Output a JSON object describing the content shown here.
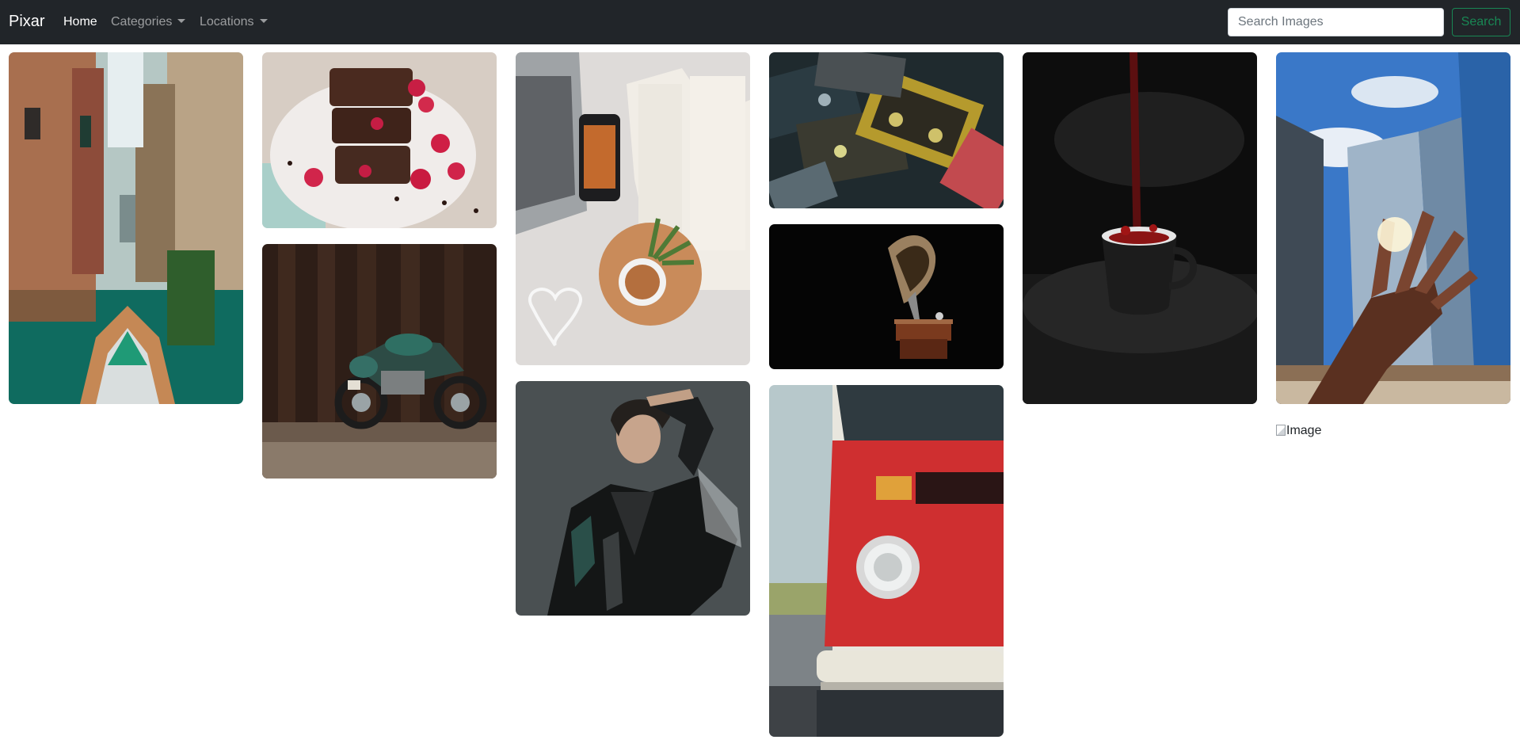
{
  "navbar": {
    "brand": "Pixar",
    "links": [
      {
        "label": "Home",
        "active": true
      },
      {
        "label": "Categories",
        "dropdown": true
      },
      {
        "label": "Locations",
        "dropdown": true
      }
    ],
    "search": {
      "placeholder": "Search Images",
      "value": "",
      "button_label": "Search"
    }
  },
  "gallery": {
    "images": [
      {
        "subject": "venice canal with boat"
      },
      {
        "subject": "chocolate brownies with raspberries"
      },
      {
        "subject": "motorcycle in forest"
      },
      {
        "subject": "laptop, phone, book and tea flat lay"
      },
      {
        "subject": "woman in shiny black jacket"
      },
      {
        "subject": "cassette tapes"
      },
      {
        "subject": "gramophone on dark background"
      },
      {
        "subject": "red volkswagen van front"
      },
      {
        "subject": "coffee pouring into black cup"
      },
      {
        "subject": "hand against city skyscrapers"
      }
    ],
    "broken_image_alt": "Image"
  },
  "colors": {
    "navbar_bg": "#212529",
    "search_button": "#198754"
  }
}
